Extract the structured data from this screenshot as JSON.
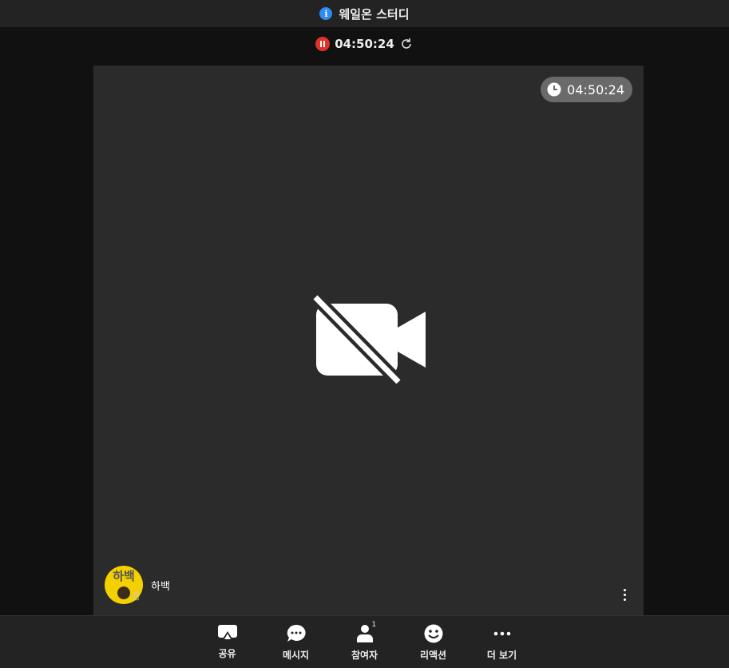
{
  "header": {
    "title": "웨일온 스터디",
    "icon": "info-icon"
  },
  "recording": {
    "elapsed": "04:50:24",
    "status": "paused"
  },
  "video": {
    "timer": "04:50:24",
    "camera_state": "off"
  },
  "participant": {
    "avatar_text": "하백",
    "name": "하백",
    "mic": "muted"
  },
  "toolbar": {
    "share": "공유",
    "message": "메시지",
    "participants": "참여자",
    "participants_count": "1",
    "reaction": "리액션",
    "more": "더 보기"
  },
  "colors": {
    "accent": "#2d8cf0",
    "record": "#e0312b",
    "avatar": "#f5d000"
  }
}
